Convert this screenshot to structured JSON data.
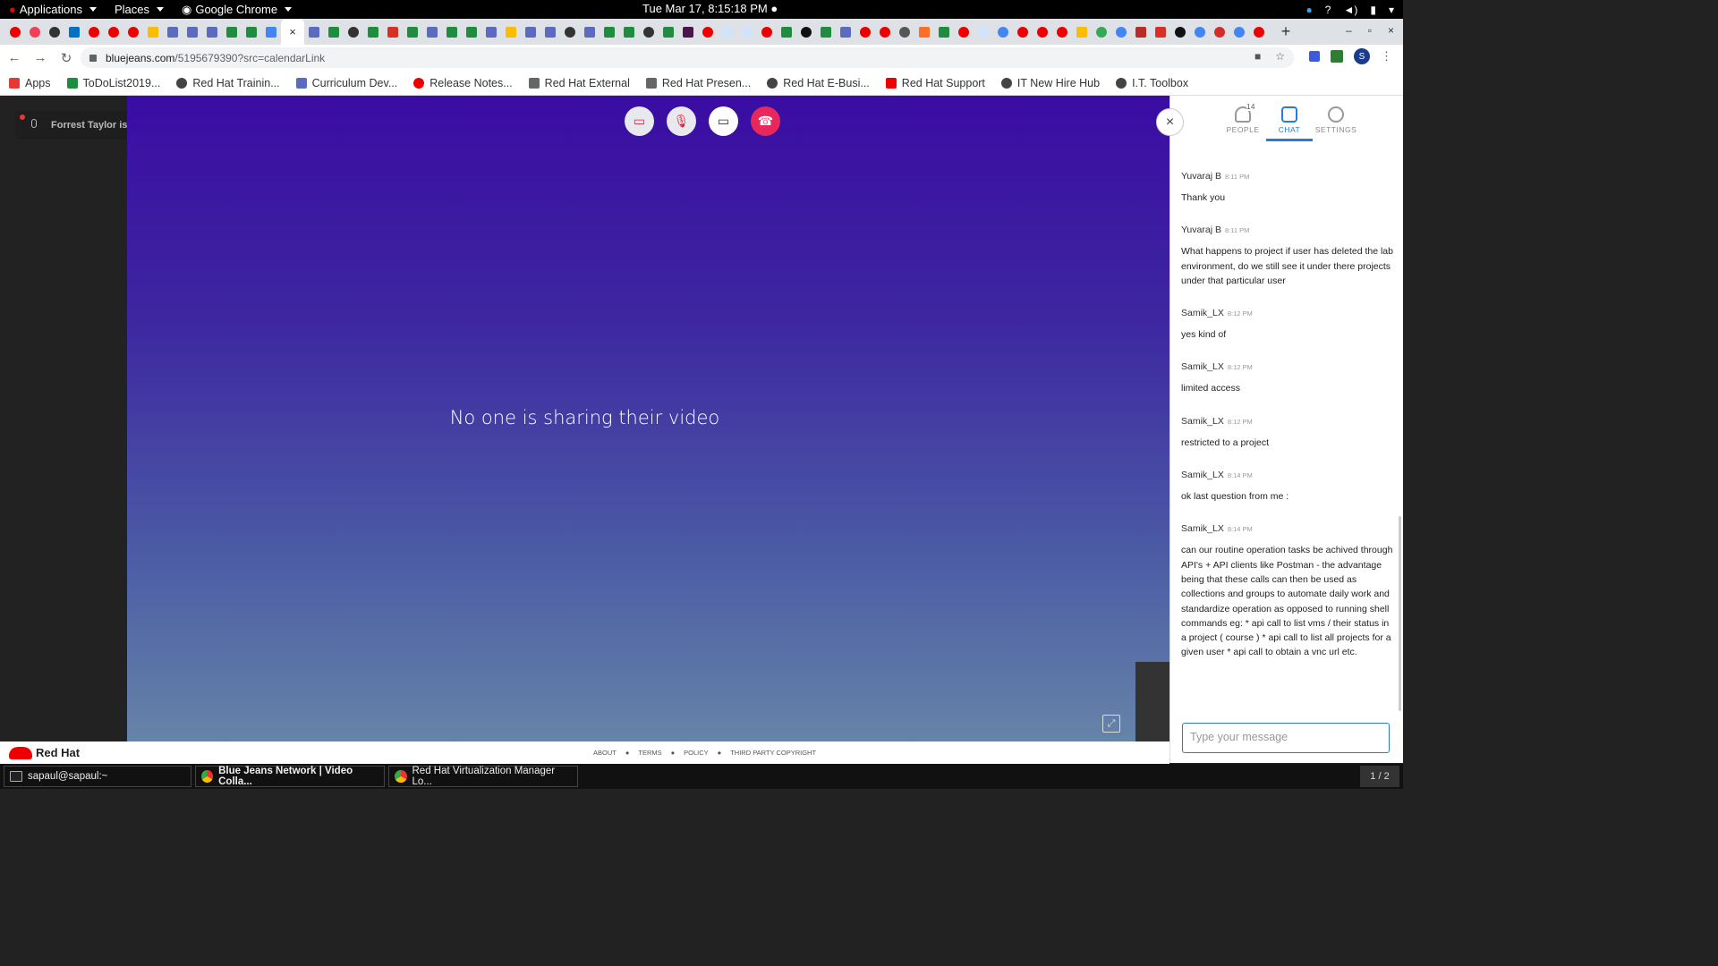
{
  "system_bar": {
    "applications": "Applications",
    "places": "Places",
    "browser": "Google Chrome",
    "clock": "Tue Mar 17,  8:15:18 PM",
    "tray_help": "?"
  },
  "browser": {
    "url_host": "bluejeans.com",
    "url_path": "/5195679390?src=calendarLink",
    "avatar_letter": "S",
    "active_tab_close": "×",
    "add_tab": "+"
  },
  "bookmarks": [
    {
      "label": "Apps",
      "color": "#e53935"
    },
    {
      "label": "ToDoList2019...",
      "color": "#1e8e3e"
    },
    {
      "label": "Red Hat Trainin...",
      "color": "#444444"
    },
    {
      "label": "Curriculum Dev...",
      "color": "#5c6bc0"
    },
    {
      "label": "Release Notes...",
      "color": "#e00000"
    },
    {
      "label": "Red Hat External",
      "color": "#666666"
    },
    {
      "label": "Red Hat Presen...",
      "color": "#666666"
    },
    {
      "label": "Red Hat E-Busi...",
      "color": "#444444"
    },
    {
      "label": "Red Hat Support",
      "color": "#e00000"
    },
    {
      "label": "IT New Hire Hub",
      "color": "#444444"
    },
    {
      "label": "I.T. Toolbox",
      "color": "#444444"
    }
  ],
  "meeting": {
    "talking": "Forrest Taylor is talking",
    "no_video": "No one is sharing their video",
    "expand_icon": "⤢"
  },
  "panel": {
    "tabs": [
      {
        "label": "PEOPLE",
        "badge": "14"
      },
      {
        "label": "CHAT"
      },
      {
        "label": "SETTINGS"
      }
    ],
    "messages": [
      {
        "name": "Yuvaraj B",
        "time": "8:11 PM",
        "text": "Thank you"
      },
      {
        "name": "Yuvaraj B",
        "time": "8:11 PM",
        "text": "What happens to project if user has deleted the lab environment, do we still see it under there projects under that particular user"
      },
      {
        "name": "Samik_LX",
        "time": "8:12 PM",
        "text": "yes kind of"
      },
      {
        "name": "Samik_LX",
        "time": "8:12 PM",
        "text": "limited access"
      },
      {
        "name": "Samik_LX",
        "time": "8:12 PM",
        "text": "restricted to a project"
      },
      {
        "name": "Samik_LX",
        "time": "8:14 PM",
        "text": "ok last question from me :"
      },
      {
        "name": "Samik_LX",
        "time": "8:14 PM",
        "text": "can our routine operation tasks be achived through API's + API clients like Postman - the advantage being that these calls can then be used as collections and groups to automate daily work and standardize operation as opposed to running shell commands eg: * api call to list vms / their status in a project ( course ) * api call to list all projects for a given user * api call to obtain a vnc url etc."
      }
    ],
    "input_placeholder": "Type your message"
  },
  "footer": {
    "brand": "Red Hat",
    "links": [
      "ABOUT",
      "TERMS",
      "POLICY",
      "THIRD PARTY COPYRIGHT"
    ]
  },
  "taskbar": {
    "items": [
      "sapaul@sapaul:~",
      "Blue Jeans Network | Video Colla...",
      "Red Hat Virtualization Manager Lo..."
    ],
    "pager": "1 / 2"
  }
}
